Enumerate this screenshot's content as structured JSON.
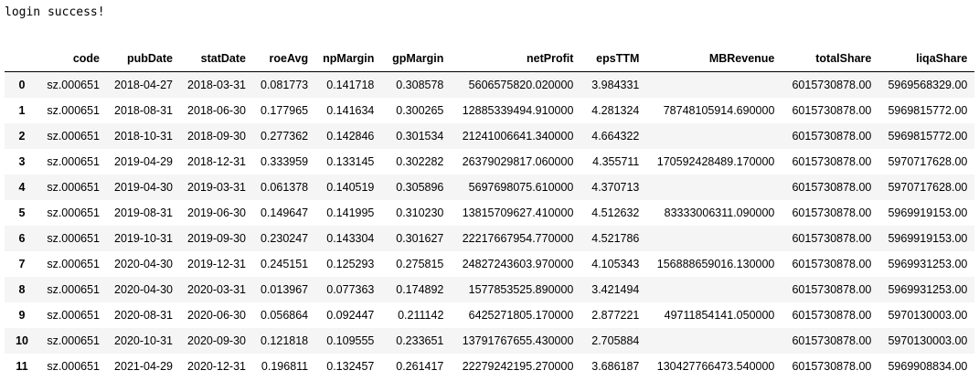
{
  "output_text": "login success!",
  "table": {
    "columns": [
      "",
      "code",
      "pubDate",
      "statDate",
      "roeAvg",
      "npMargin",
      "gpMargin",
      "netProfit",
      "epsTTM",
      "MBRevenue",
      "totalShare",
      "liqaShare"
    ],
    "rows": [
      [
        "0",
        "sz.000651",
        "2018-04-27",
        "2018-03-31",
        "0.081773",
        "0.141718",
        "0.308578",
        "5606575820.020000",
        "3.984331",
        "",
        "6015730878.00",
        "5969568329.00"
      ],
      [
        "1",
        "sz.000651",
        "2018-08-31",
        "2018-06-30",
        "0.177965",
        "0.141634",
        "0.300265",
        "12885339494.910000",
        "4.281324",
        "78748105914.690000",
        "6015730878.00",
        "5969815772.00"
      ],
      [
        "2",
        "sz.000651",
        "2018-10-31",
        "2018-09-30",
        "0.277362",
        "0.142846",
        "0.301534",
        "21241006641.340000",
        "4.664322",
        "",
        "6015730878.00",
        "5969815772.00"
      ],
      [
        "3",
        "sz.000651",
        "2019-04-29",
        "2018-12-31",
        "0.333959",
        "0.133145",
        "0.302282",
        "26379029817.060000",
        "4.355711",
        "170592428489.170000",
        "6015730878.00",
        "5970717628.00"
      ],
      [
        "4",
        "sz.000651",
        "2019-04-30",
        "2019-03-31",
        "0.061378",
        "0.140519",
        "0.305896",
        "5697698075.610000",
        "4.370713",
        "",
        "6015730878.00",
        "5970717628.00"
      ],
      [
        "5",
        "sz.000651",
        "2019-08-31",
        "2019-06-30",
        "0.149647",
        "0.141995",
        "0.310230",
        "13815709627.410000",
        "4.512632",
        "83333006311.090000",
        "6015730878.00",
        "5969919153.00"
      ],
      [
        "6",
        "sz.000651",
        "2019-10-31",
        "2019-09-30",
        "0.230247",
        "0.143304",
        "0.301627",
        "22217667954.770000",
        "4.521786",
        "",
        "6015730878.00",
        "5969919153.00"
      ],
      [
        "7",
        "sz.000651",
        "2020-04-30",
        "2019-12-31",
        "0.245151",
        "0.125293",
        "0.275815",
        "24827243603.970000",
        "4.105343",
        "156888659016.130000",
        "6015730878.00",
        "5969931253.00"
      ],
      [
        "8",
        "sz.000651",
        "2020-04-30",
        "2020-03-31",
        "0.013967",
        "0.077363",
        "0.174892",
        "1577853525.890000",
        "3.421494",
        "",
        "6015730878.00",
        "5969931253.00"
      ],
      [
        "9",
        "sz.000651",
        "2020-08-31",
        "2020-06-30",
        "0.056864",
        "0.092447",
        "0.211142",
        "6425271805.170000",
        "2.877221",
        "49711854141.050000",
        "6015730878.00",
        "5970130003.00"
      ],
      [
        "10",
        "sz.000651",
        "2020-10-31",
        "2020-09-30",
        "0.121818",
        "0.109555",
        "0.233651",
        "13791767655.430000",
        "2.705884",
        "",
        "6015730878.00",
        "5970130003.00"
      ],
      [
        "11",
        "sz.000651",
        "2021-04-29",
        "2020-12-31",
        "0.196811",
        "0.132457",
        "0.261417",
        "22279242195.270000",
        "3.686187",
        "130427766473.540000",
        "6015730878.00",
        "5969908834.00"
      ]
    ]
  }
}
